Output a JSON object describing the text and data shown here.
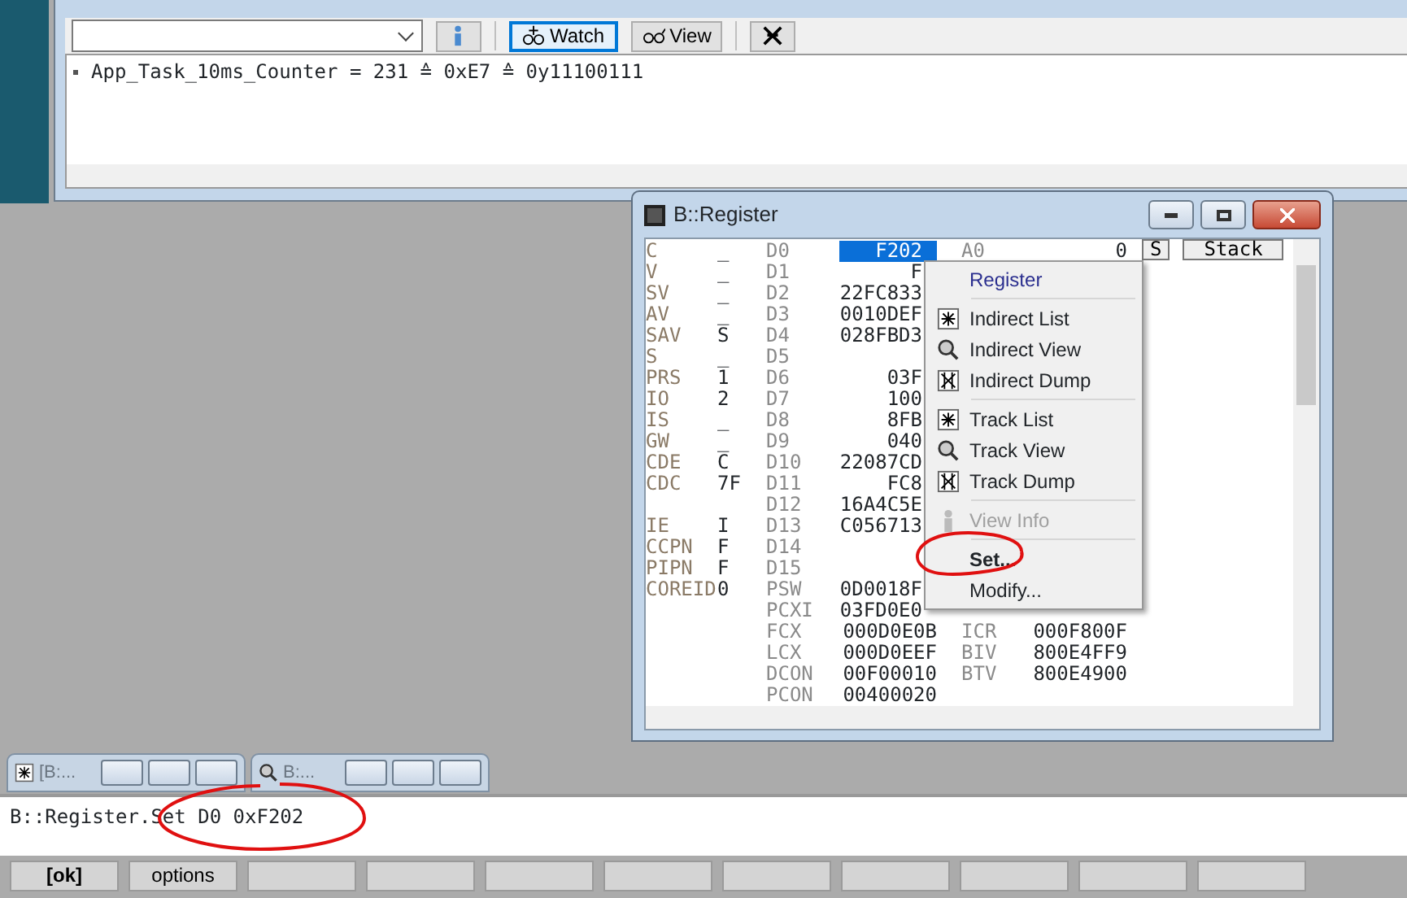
{
  "watch_window": {
    "toolbar": [
      {
        "kind": "combo"
      },
      {
        "kind": "info"
      },
      {
        "kind": "watch",
        "label": "Watch",
        "focused": true
      },
      {
        "kind": "view",
        "label": "View",
        "focused": false
      },
      {
        "kind": "clear"
      }
    ],
    "lines": [
      "App_Task_10ms_Counter = 231 ≙ 0xE7 ≙ 0y11100111"
    ]
  },
  "register_window": {
    "title": "B::Register",
    "rows": [
      {
        "flag": "C",
        "flag_value": "_",
        "reg": "D0",
        "value": "F202",
        "selected": true,
        "reg2": "A0",
        "value2": "0"
      },
      {
        "flag": "V",
        "flag_value": "_",
        "reg": "D1",
        "value": "F",
        "selected": false
      },
      {
        "flag": "SV",
        "flag_value": "_",
        "reg": "D2",
        "value": "22FC833",
        "selected": false
      },
      {
        "flag": "AV",
        "flag_value": "_",
        "reg": "D3",
        "value": "0010DEF",
        "selected": false
      },
      {
        "flag": "SAV",
        "flag_value": "S",
        "reg": "D4",
        "value": "028FBD3",
        "selected": false
      },
      {
        "flag": "S",
        "flag_value": "_",
        "reg": "D5",
        "selected": false
      },
      {
        "flag": "PRS",
        "flag_value": "1",
        "reg": "D6",
        "value": "03F",
        "selected": false
      },
      {
        "flag": "IO",
        "flag_value": "2",
        "reg": "D7",
        "value": "100",
        "selected": false
      },
      {
        "flag": "IS",
        "flag_value": "_",
        "reg": "D8",
        "value": "8FB",
        "selected": false
      },
      {
        "flag": "GW",
        "flag_value": "_",
        "reg": "D9",
        "value": "040",
        "selected": false
      },
      {
        "flag": "CDE",
        "flag_value": "C",
        "reg": "D10",
        "value": "22087CD",
        "selected": false
      },
      {
        "flag": "CDC",
        "flag_value": "7F",
        "reg": "D11",
        "value": "FC8",
        "selected": false
      },
      {
        "reg": "D12",
        "value": "16A4C5E",
        "selected": false
      },
      {
        "flag": "IE",
        "flag_value": "I",
        "reg": "D13",
        "value": "C056713",
        "selected": false
      },
      {
        "flag": "CCPN",
        "flag_value": "F",
        "reg": "D14",
        "selected": false
      },
      {
        "flag": "PIPN",
        "flag_value": "F",
        "reg": "D15",
        "selected": false
      },
      {
        "flag": "COREID",
        "flag_value": "0",
        "reg": "PSW",
        "value": "0D0018F",
        "selected": false
      },
      {
        "reg": "PCXI",
        "value": "03FD0E0",
        "selected": false
      },
      {
        "reg": "FCX",
        "value": "000D0E0B",
        "selected": false,
        "reg2": "ICR",
        "value2": "000F800F"
      },
      {
        "reg": "LCX",
        "value": "000D0EEF",
        "selected": false,
        "reg2": "BIV",
        "value2": "800E4FF9"
      },
      {
        "reg": "DCON",
        "value": "00F00010",
        "selected": false,
        "reg2": "BTV",
        "value2": "800E4900"
      },
      {
        "reg": "PCON",
        "value": "00400020",
        "selected": false
      }
    ],
    "side_buttons": [
      "S",
      "Stack"
    ]
  },
  "context_menu": [
    {
      "kind": "header",
      "label": "Register"
    },
    {
      "kind": "list",
      "label": "Indirect List",
      "disabled": false,
      "separator_before": true
    },
    {
      "kind": "view",
      "label": "Indirect View",
      "disabled": false,
      "separator_before": false
    },
    {
      "kind": "dump",
      "label": "Indirect Dump",
      "disabled": false,
      "separator_before": false
    },
    {
      "kind": "list",
      "label": "Track List",
      "disabled": false,
      "separator_before": true
    },
    {
      "kind": "view",
      "label": "Track View",
      "disabled": false,
      "separator_before": false
    },
    {
      "kind": "dump",
      "label": "Track Dump",
      "disabled": false,
      "separator_before": false
    },
    {
      "kind": "info",
      "label": "View Info",
      "disabled": true,
      "separator_before": true
    },
    {
      "kind": "default",
      "label": "Set...",
      "disabled": false,
      "separator_before": true
    },
    {
      "kind": "plain",
      "label": "Modify...",
      "disabled": false,
      "separator_before": false
    }
  ],
  "minimized_windows": [
    {
      "kind": "list",
      "label": "[B:..."
    },
    {
      "kind": "view",
      "label": "B:..."
    }
  ],
  "command_line": "B::Register.Set D0 0xF202",
  "softkeys": [
    {
      "label": "[ok]",
      "bold": true
    },
    {
      "label": "options",
      "bold": false
    }
  ]
}
